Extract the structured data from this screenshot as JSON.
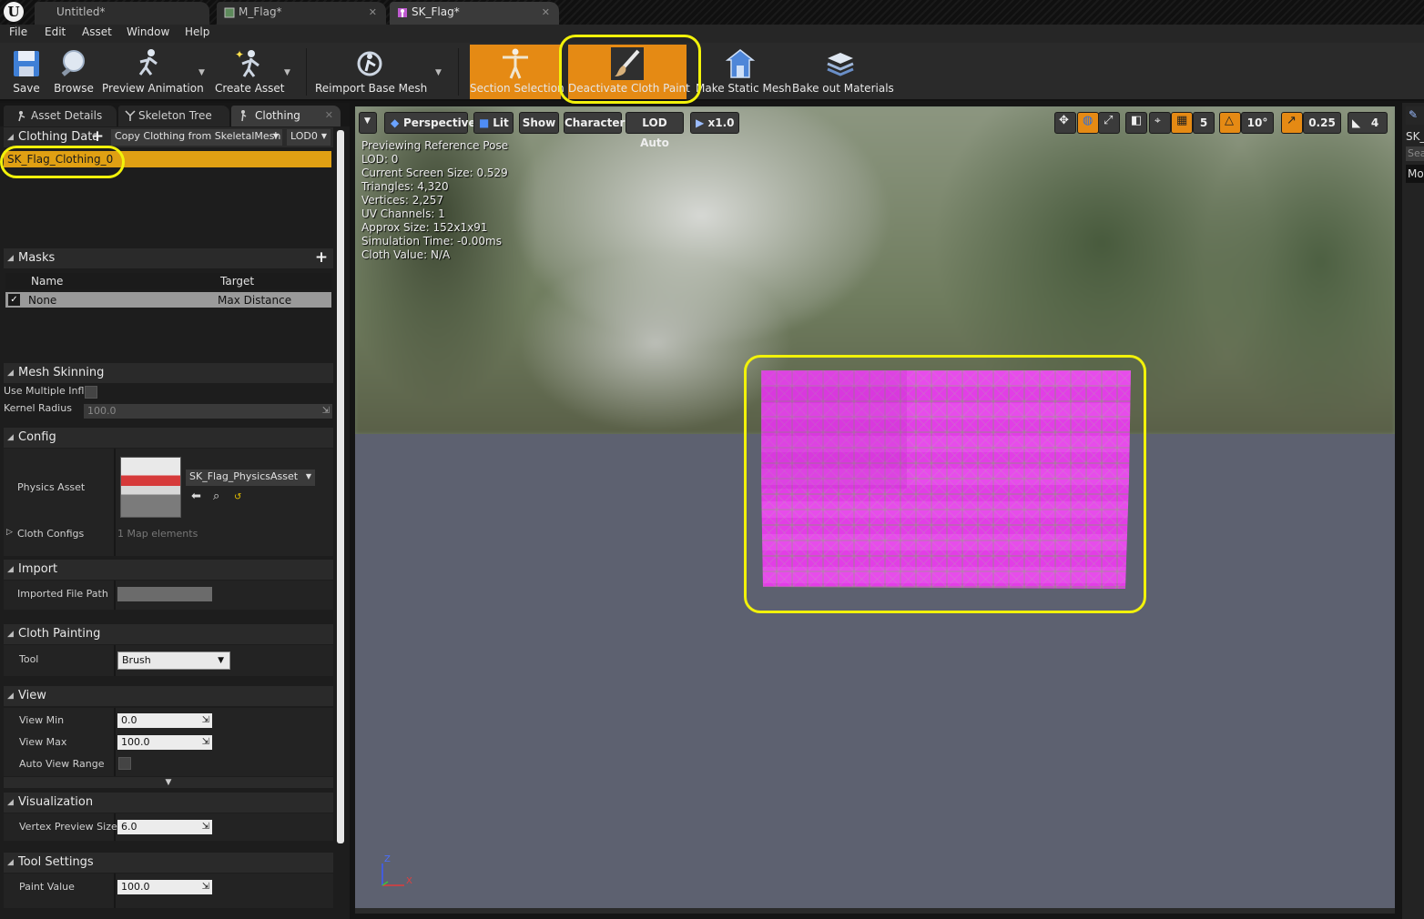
{
  "tabs": [
    {
      "label": "Untitled*"
    },
    {
      "label": "M_Flag*"
    },
    {
      "label": "SK_Flag*"
    }
  ],
  "menu": [
    "File",
    "Edit",
    "Asset",
    "Window",
    "Help"
  ],
  "toolbar": {
    "save": "Save",
    "browse": "Browse",
    "preview_animation": "Preview Animation",
    "create_asset": "Create Asset",
    "reimport": "Reimport Base Mesh",
    "section_selection": "Section Selection",
    "deactivate_cloth_paint": "Deactivate Cloth Paint",
    "make_static_mesh": "Make Static Mesh",
    "bake_materials": "Bake out Materials"
  },
  "panel_tabs": [
    "Asset Details",
    "Skeleton Tree",
    "Clothing"
  ],
  "clothing_data": {
    "title": "Clothing Data",
    "copy_btn": "Copy Clothing from SkeletalMesh",
    "lod": "LOD0",
    "selected_item": "SK_Flag_Clothing_0"
  },
  "masks": {
    "title": "Masks",
    "col_name": "Name",
    "col_target": "Target",
    "row_name": "None",
    "row_target": "Max Distance"
  },
  "mesh_skinning": {
    "title": "Mesh Skinning",
    "use_multiple": "Use Multiple Infl",
    "kernel_radius_label": "Kernel Radius",
    "kernel_radius_value": "100.0"
  },
  "config": {
    "title": "Config",
    "physics_asset_label": "Physics Asset",
    "physics_asset_value": "SK_Flag_PhysicsAsset",
    "cloth_configs_label": "Cloth Configs",
    "cloth_configs_value": "1 Map elements"
  },
  "import": {
    "title": "Import",
    "imported_file_path": "Imported File Path"
  },
  "cloth_painting": {
    "title": "Cloth Painting",
    "tool_label": "Tool",
    "tool_value": "Brush"
  },
  "view": {
    "title": "View",
    "min_label": "View Min",
    "min_value": "0.0",
    "max_label": "View Max",
    "max_value": "100.0",
    "auto_label": "Auto View Range"
  },
  "visualization": {
    "title": "Visualization",
    "vertex_label": "Vertex Preview Size",
    "vertex_value": "6.0"
  },
  "tool_settings": {
    "title": "Tool Settings",
    "paint_label": "Paint Value",
    "paint_value": "100.0"
  },
  "viewport": {
    "perspective": "Perspective",
    "lit": "Lit",
    "show": "Show",
    "character": "Character",
    "lod_auto": "LOD Auto",
    "speed": "x1.0",
    "grid": "5",
    "angle": "10°",
    "scale": "0.25",
    "camera_speed": "4",
    "overlay": [
      "Previewing Reference Pose",
      "LOD: 0",
      "Current Screen Size: 0.529",
      "Triangles: 4,320",
      "Vertices: 2,257",
      "UV Channels: 1",
      "Approx Size: 152x1x91",
      "Simulation Time: -0.00ms",
      "Cloth Value: N/A"
    ],
    "axis_z": "Z",
    "axis_x": "X"
  },
  "right_strip": {
    "title": "SK_",
    "search": "Sea",
    "mode": "Mo"
  },
  "colors": {
    "accent_orange": "#e58a14",
    "selection_yellow": "#f2f20a",
    "flag_paint": "#e23ee6"
  }
}
